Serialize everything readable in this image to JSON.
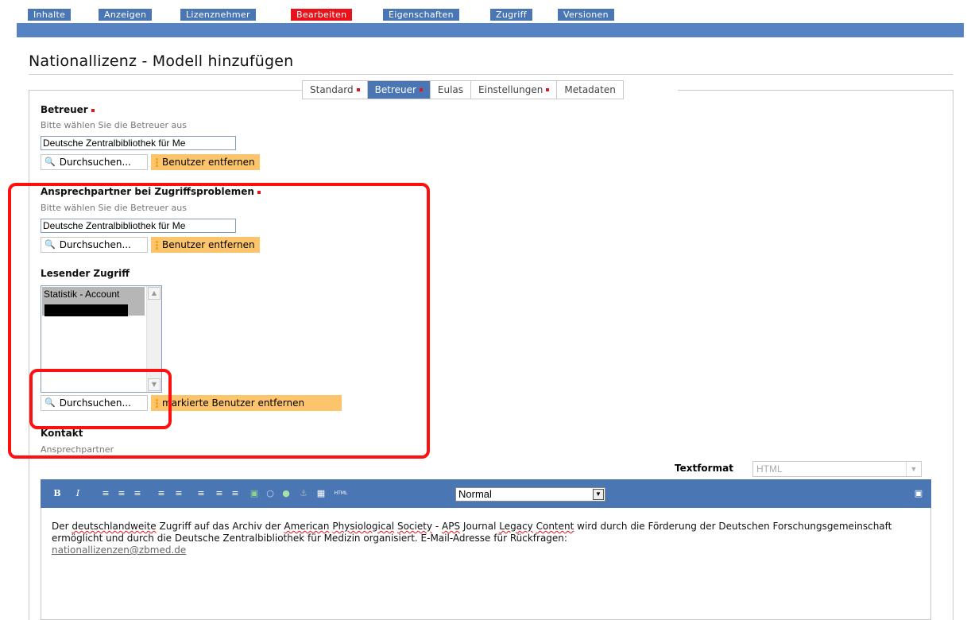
{
  "top_tabs": [
    "Inhalte",
    "Anzeigen",
    "Lizenznehmer",
    "Bearbeiten",
    "Eigenschaften",
    "Zugriff",
    "Versionen"
  ],
  "page_title": "Nationallizenz - Modell hinzufügen",
  "sub_tabs": [
    "Standard",
    "Betreuer",
    "Eulas",
    "Einstellungen",
    "Metadaten"
  ],
  "betreuer": {
    "label": "Betreuer",
    "help": "Bitte wählen Sie die Betreuer aus",
    "value": "Deutsche Zentralbibliothek für Me",
    "search_button": "Durchsuchen...",
    "remove_button": "Benutzer entfernen"
  },
  "ansprechpartner": {
    "label": "Ansprechpartner bei Zugriffsproblemen",
    "help": "Bitte wählen Sie die Betreuer aus",
    "value": "Deutsche Zentralbibliothek für Me",
    "search_button": "Durchsuchen...",
    "remove_button": "Benutzer entfernen"
  },
  "lesender_zugriff": {
    "label": "Lesender Zugriff",
    "items": [
      "Statistik - Account"
    ],
    "search_button": "Durchsuchen...",
    "remove_button": "markierte Benutzer entfernen"
  },
  "kontakt": {
    "label": "Kontakt",
    "help": "Ansprechpartner"
  },
  "textformat": {
    "label": "Textformat",
    "value": "HTML"
  },
  "editor": {
    "format_value": "Normal",
    "text_part1": "Der ",
    "w_deutschlandweite": "deutschlandweite",
    "text_part2": " Zugriff auf das Archiv der ",
    "w_american": "American",
    "text_part3": " ",
    "w_physiological": "Physiological",
    "text_part4": " ",
    "w_society": "Society",
    "text_part5": " - ",
    "w_aps": "APS",
    "text_part6": " Journal ",
    "w_legacy": "Legacy",
    "text_part7": " ",
    "w_content": "Content",
    "text_part8": " wird durch die Förderung der Deutschen Forschungsgemeinschaft ermöglicht und durch die Deutsche Zentralbibliothek für Medizin organisiert. E-Mail-Adresse für Rückfragen: ",
    "email": "nationallizenzen@zbmed.de"
  },
  "colors": {
    "accent_blue": "#4a76b4",
    "active_red": "#e8121b",
    "button_orange": "#fdc56b",
    "annotation_red": "#ff1010"
  }
}
